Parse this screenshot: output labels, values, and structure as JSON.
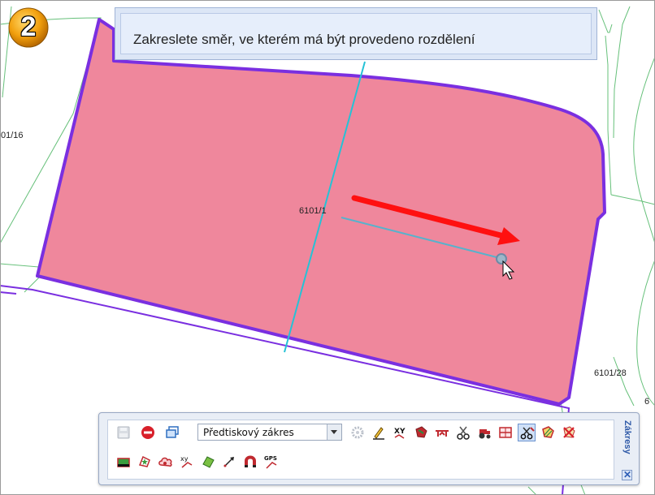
{
  "step_badge": {
    "number": "2"
  },
  "instruction_banner": {
    "text": "Zakreslete směr, ve kterém má být provedeno rozdělení"
  },
  "parcel_labels": [
    {
      "name": "parcel-label-6101-1",
      "text": "6101/1"
    },
    {
      "name": "parcel-label-01-16",
      "text": "01/16"
    },
    {
      "name": "parcel-label-6101-28",
      "text": "6101/28"
    },
    {
      "name": "parcel-label-6-partial",
      "text": "6"
    }
  ],
  "colors": {
    "parcel_fill": "#ef879c",
    "parcel_border": "#7a2fe0",
    "split_line": "#25c2d6",
    "other_parcels": "#66c07a",
    "direction_arrow": "#ff1010",
    "drawn_segment": "#58b2cc"
  },
  "toolbar": {
    "title": "Zákresy",
    "close_label": "✕",
    "template_select": {
      "value": "Předtiskový zákres"
    },
    "row1_icons": [
      "save-icon",
      "stop-icon",
      "windows-icon",
      "dropdown",
      "gear-icon",
      "pencil-icon",
      "xy-coordinates-icon",
      "fill-polygon-icon",
      "red-segment-icon",
      "scissors-icon",
      "tractor-icon",
      "split-parcel-icon",
      "cut-polygon-icon",
      "hatched-polygon-icon",
      "delete-hatched-icon"
    ],
    "row2_icons": [
      "polygon-green-icon",
      "star-vertex-icon",
      "cloud-polygon-icon",
      "xy-line-icon",
      "green-leaf-icon",
      "arrow-line-icon",
      "magnet-icon",
      "gps-line-icon"
    ]
  }
}
